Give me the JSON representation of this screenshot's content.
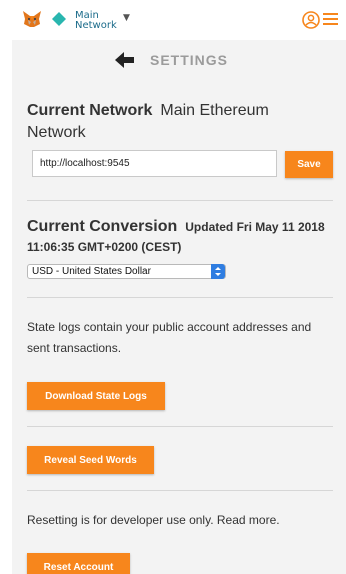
{
  "header": {
    "network_line1": "Main",
    "network_line2": "Network",
    "caret": "▼",
    "colors": {
      "accent": "#f7861c",
      "network": "#29b6af"
    }
  },
  "settings": {
    "title": "SETTINGS",
    "current_network": {
      "label": "Current Network",
      "value": "Main Ethereum Network",
      "rpc_value": "http://localhost:9545",
      "save_label": "Save"
    },
    "current_conversion": {
      "label": "Current Conversion",
      "updated": "Updated Fri May 11 2018 11:06:35 GMT+0200 (CEST)",
      "selected": "USD - United States Dollar"
    },
    "state_logs": {
      "text": "State logs contain your public account addresses and sent transactions.",
      "button": "Download State Logs"
    },
    "seed": {
      "button": "Reveal Seed Words"
    },
    "reset": {
      "text": "Resetting is for developer use only. Read more.",
      "button": "Reset Account"
    }
  }
}
